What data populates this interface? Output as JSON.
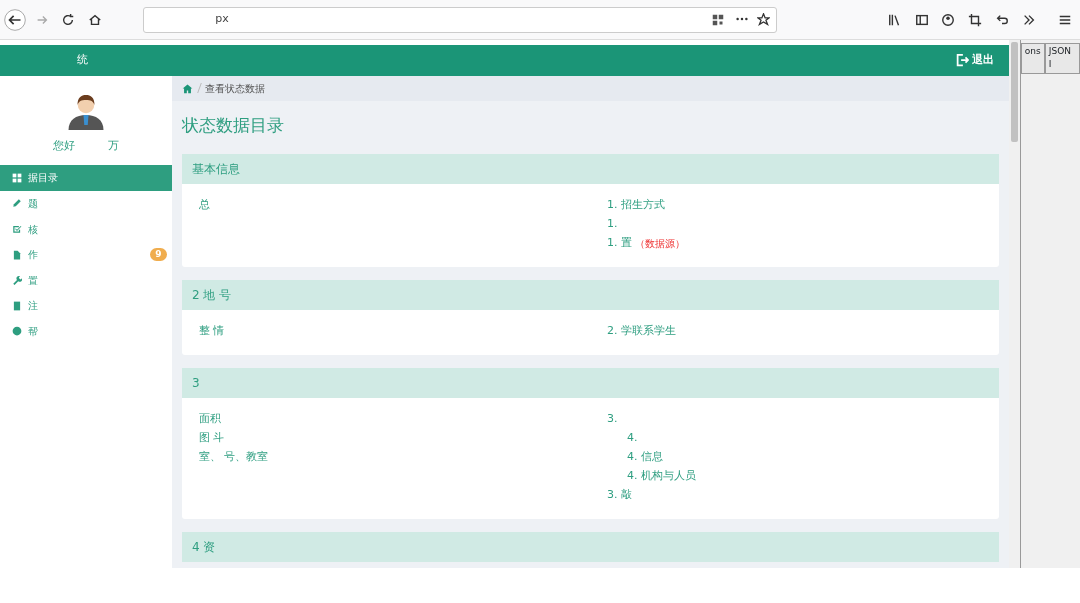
{
  "browser": {
    "url": "px"
  },
  "side_window": {
    "tabs": [
      "ons",
      "JSON I"
    ]
  },
  "navbar": {
    "brand": "统",
    "logout": "退出"
  },
  "sidebar": {
    "greeting": "您好",
    "user": "万",
    "items": [
      {
        "label": "据目录",
        "selected": true
      },
      {
        "label": "题",
        "selected": false
      },
      {
        "label": "核",
        "selected": false
      },
      {
        "label": "作",
        "selected": false,
        "badge": "9"
      },
      {
        "label": "置",
        "selected": false
      },
      {
        "label": "注",
        "selected": false
      },
      {
        "label": "帮",
        "selected": false
      }
    ]
  },
  "breadcrumb": "查看状态数据",
  "page_title": "状态数据目录",
  "sections": [
    {
      "title": "基本信息",
      "left": [
        {
          "text": "总"
        }
      ],
      "right": [
        {
          "text": "1.    招生方式"
        },
        {
          "text": "1."
        },
        {
          "text": "1.     置",
          "note": "（数据源）"
        }
      ]
    },
    {
      "title": "2    地   号",
      "left": [
        {
          "text": "整   情"
        }
      ],
      "right": [
        {
          "text": "2.       学联系学生"
        }
      ]
    },
    {
      "title": "3",
      "left": [
        {
          "text": "面积"
        },
        {
          "text": "图   斗"
        },
        {
          "text": "室、   号、教室"
        }
      ],
      "right": [
        {
          "text": "3."
        },
        {
          "text": "4.",
          "indent": true
        },
        {
          "text": "4.    信息",
          "indent": true
        },
        {
          "text": "4.     机构与人员",
          "indent": true
        },
        {
          "text": "3.   敲"
        }
      ]
    },
    {
      "title": "4 资"
    }
  ]
}
